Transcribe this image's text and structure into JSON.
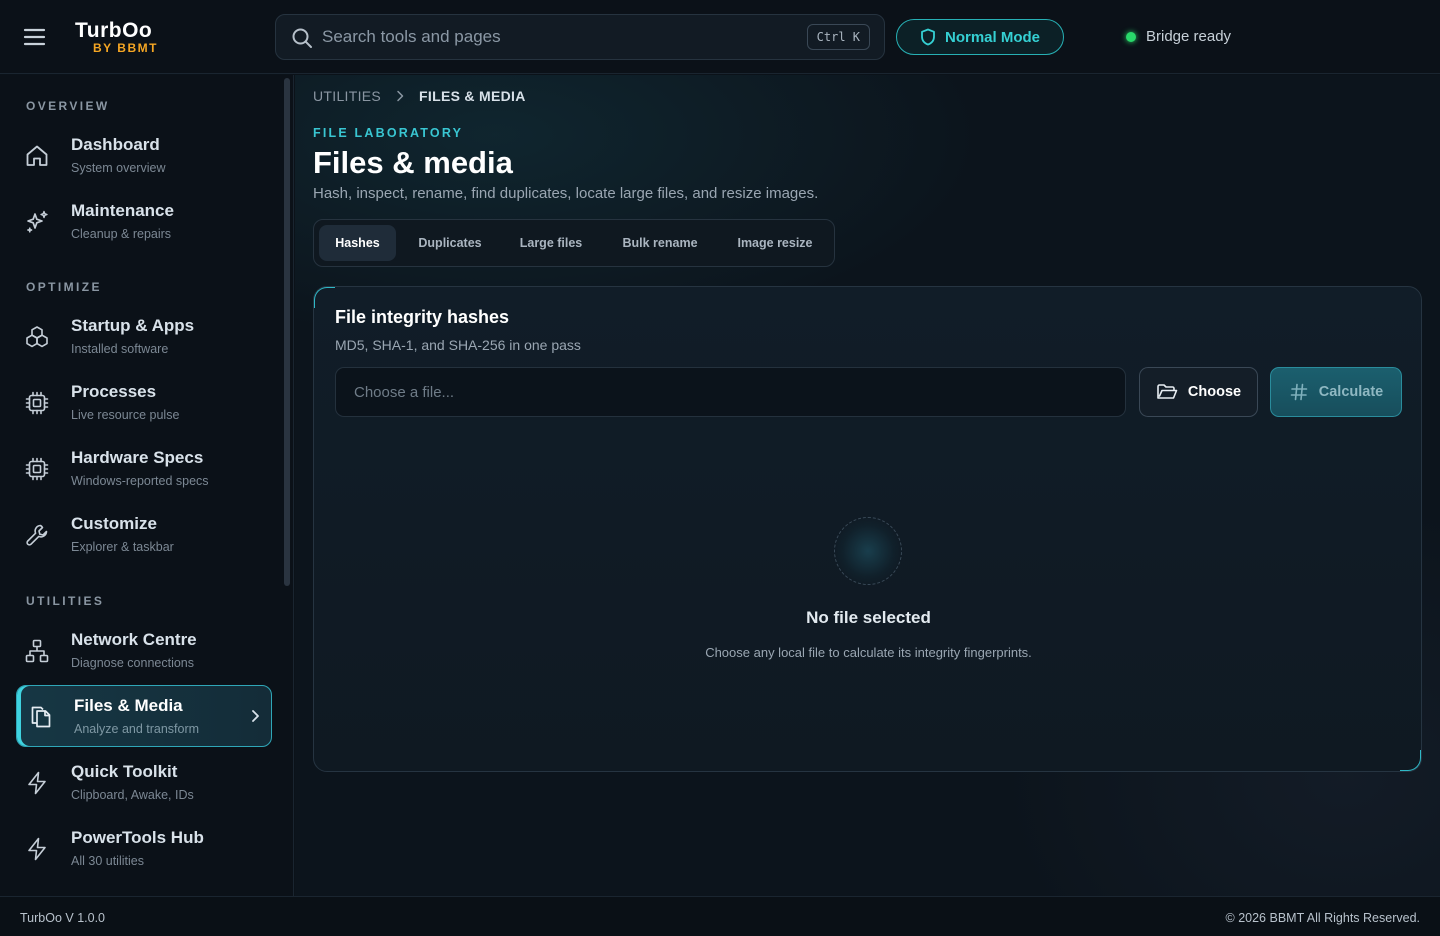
{
  "brand": {
    "name": "TurbOo",
    "sub": "BY BBMT"
  },
  "search": {
    "placeholder": "Search tools and pages",
    "shortcut": "Ctrl K"
  },
  "mode": {
    "label": "Normal Mode"
  },
  "status": {
    "label": "Bridge ready",
    "color": "#29d86a"
  },
  "sidebar": {
    "sections": [
      {
        "label": "OVERVIEW"
      },
      {
        "label": "OPTIMIZE"
      },
      {
        "label": "UTILITIES"
      }
    ],
    "items": [
      {
        "title": "Dashboard",
        "sub": "System overview",
        "icon": "home-icon"
      },
      {
        "title": "Maintenance",
        "sub": "Cleanup & repairs",
        "icon": "sparkles-icon"
      },
      {
        "title": "Startup & Apps",
        "sub": "Installed software",
        "icon": "boxes-icon"
      },
      {
        "title": "Processes",
        "sub": "Live resource pulse",
        "icon": "cpu-icon"
      },
      {
        "title": "Hardware Specs",
        "sub": "Windows-reported specs",
        "icon": "chip-icon"
      },
      {
        "title": "Customize",
        "sub": "Explorer & taskbar",
        "icon": "wrench-icon"
      },
      {
        "title": "Network Centre",
        "sub": "Diagnose connections",
        "icon": "network-icon"
      },
      {
        "title": "Files & Media",
        "sub": "Analyze and transform",
        "icon": "copy-icon",
        "active": true
      },
      {
        "title": "Quick Toolkit",
        "sub": "Clipboard, Awake, IDs",
        "icon": "bolt-icon"
      },
      {
        "title": "PowerTools Hub",
        "sub": "All 30 utilities",
        "icon": "bolt-icon"
      }
    ]
  },
  "breadcrumb": {
    "parent": "UTILITIES",
    "current": "FILES & MEDIA"
  },
  "page": {
    "eyebrow": "FILE LABORATORY",
    "title": "Files & media",
    "subtitle": "Hash, inspect, rename, find duplicates, locate large files, and resize images."
  },
  "tabs": [
    {
      "label": "Hashes",
      "active": true
    },
    {
      "label": "Duplicates"
    },
    {
      "label": "Large files"
    },
    {
      "label": "Bulk rename"
    },
    {
      "label": "Image resize"
    }
  ],
  "card": {
    "title": "File integrity hashes",
    "subtitle": "MD5, SHA-1, and SHA-256 in one pass",
    "input_placeholder": "Choose a file...",
    "choose_label": "Choose",
    "calculate_label": "Calculate",
    "empty_title": "No file selected",
    "empty_sub": "Choose any local file to calculate its integrity fingerprints."
  },
  "footer": {
    "version": "TurbOo V 1.0.0",
    "copyright": "© 2026 BBMT All Rights Reserved."
  },
  "colors": {
    "accent": "#35d0d3",
    "brand_sub": "#f5a623",
    "background": "#0c141c"
  }
}
